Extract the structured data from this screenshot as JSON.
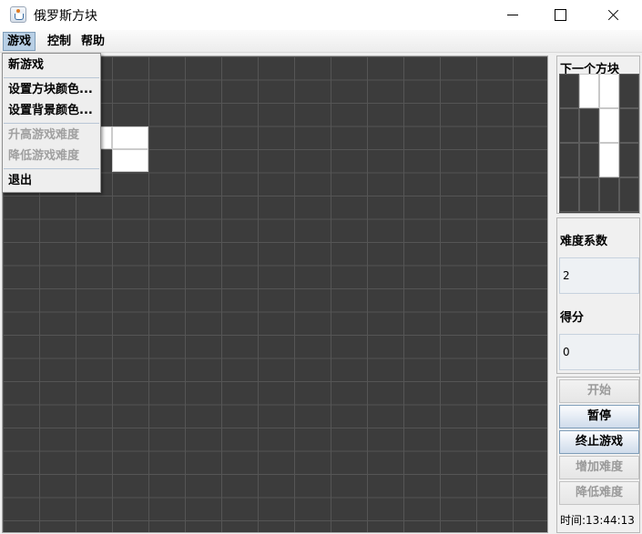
{
  "window": {
    "title": "俄罗斯方块",
    "icon": "java-cup-icon"
  },
  "menubar": {
    "game": "游戏",
    "control": "控制",
    "help": "帮助"
  },
  "game_menu": {
    "items": [
      {
        "label": "新游戏",
        "enabled": true
      },
      {
        "label": "设置方块颜色...",
        "enabled": true
      },
      {
        "label": "设置背景颜色...",
        "enabled": true
      },
      {
        "label": "升高游戏难度",
        "enabled": false
      },
      {
        "label": "降低游戏难度",
        "enabled": false
      },
      {
        "label": "退出",
        "enabled": true
      }
    ]
  },
  "board": {
    "columns": 15,
    "rows": 20,
    "background_color": "#3c3c3c",
    "block_color": "#ffffff",
    "filled_cells": [
      [
        0,
        3
      ],
      [
        1,
        3
      ],
      [
        2,
        3
      ],
      [
        3,
        3
      ],
      [
        3,
        4
      ]
    ]
  },
  "next_piece": {
    "title": "下一个方块",
    "columns": 4,
    "rows": 4,
    "filled_cells": [
      [
        1,
        0
      ],
      [
        2,
        0
      ],
      [
        2,
        1
      ],
      [
        2,
        2
      ]
    ]
  },
  "stats": {
    "difficulty_label": "难度系数",
    "difficulty_value": "2",
    "score_label": "得分",
    "score_value": "0"
  },
  "controls": {
    "start": "开始",
    "pause": "暂停",
    "stop": "终止游戏",
    "increase": "增加难度",
    "decrease": "降低难度"
  },
  "clock": "时间:13:44:13"
}
